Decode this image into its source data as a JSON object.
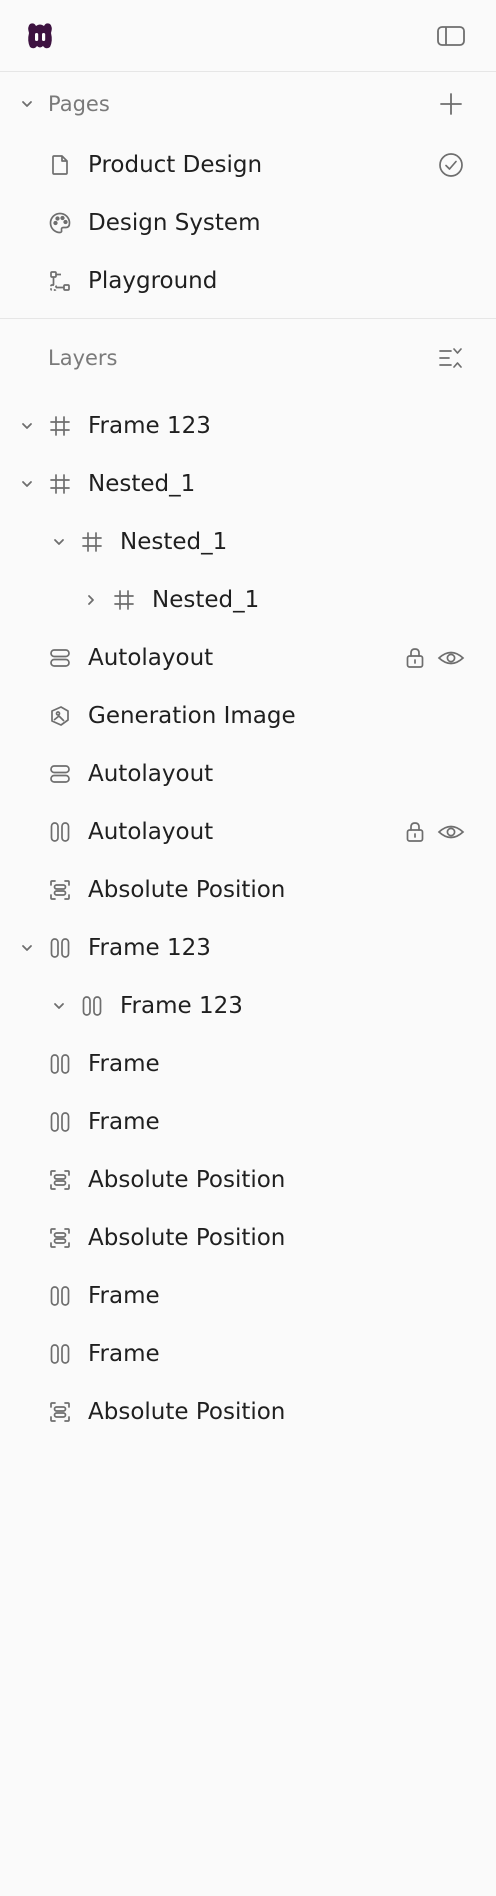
{
  "pages": {
    "title": "Pages",
    "items": [
      {
        "label": "Product Design",
        "icon": "file-icon",
        "current": true
      },
      {
        "label": "Design System",
        "icon": "palette-icon"
      },
      {
        "label": "Playground",
        "icon": "component-icon"
      }
    ]
  },
  "layers": {
    "title": "Layers",
    "items": [
      {
        "label": "Frame 123",
        "icon": "hash-icon",
        "level": 0,
        "chevron": "down"
      },
      {
        "label": "Nested_1",
        "icon": "hash-icon",
        "level": 0,
        "chevron": "down"
      },
      {
        "label": "Nested_1",
        "icon": "hash-icon",
        "level": 1,
        "chevron": "down"
      },
      {
        "label": "Nested_1",
        "icon": "hash-icon",
        "level": 2,
        "chevron": "right"
      },
      {
        "label": "Autolayout",
        "icon": "rows-icon",
        "level": 0,
        "locked": true,
        "visible": true
      },
      {
        "label": "Generation Image",
        "icon": "image-icon",
        "level": 0
      },
      {
        "label": "Autolayout",
        "icon": "rows-icon",
        "level": 0
      },
      {
        "label": "Autolayout",
        "icon": "columns-icon",
        "level": 0,
        "locked": true,
        "visible": true
      },
      {
        "label": "Absolute Position",
        "icon": "absolute-icon",
        "level": 0
      },
      {
        "label": "Frame 123",
        "icon": "columns-icon",
        "level": 0,
        "chevron": "down"
      },
      {
        "label": "Frame 123",
        "icon": "columns-icon",
        "level": 1,
        "chevron": "down"
      },
      {
        "label": "Frame",
        "icon": "columns-icon",
        "level": 0
      },
      {
        "label": "Frame",
        "icon": "columns-icon",
        "level": 0
      },
      {
        "label": "Absolute Position",
        "icon": "absolute-icon",
        "level": 0
      },
      {
        "label": "Absolute Position",
        "icon": "absolute-icon",
        "level": 0
      },
      {
        "label": "Frame",
        "icon": "columns-icon",
        "level": 0
      },
      {
        "label": "Frame",
        "icon": "columns-icon",
        "level": 0
      },
      {
        "label": "Absolute Position",
        "icon": "absolute-icon",
        "level": 0
      }
    ]
  },
  "colors": {
    "logo": "#3d1240",
    "icon": "#7a7a7a",
    "text": "#1f1f1f",
    "muted": "#7a7a7a"
  }
}
